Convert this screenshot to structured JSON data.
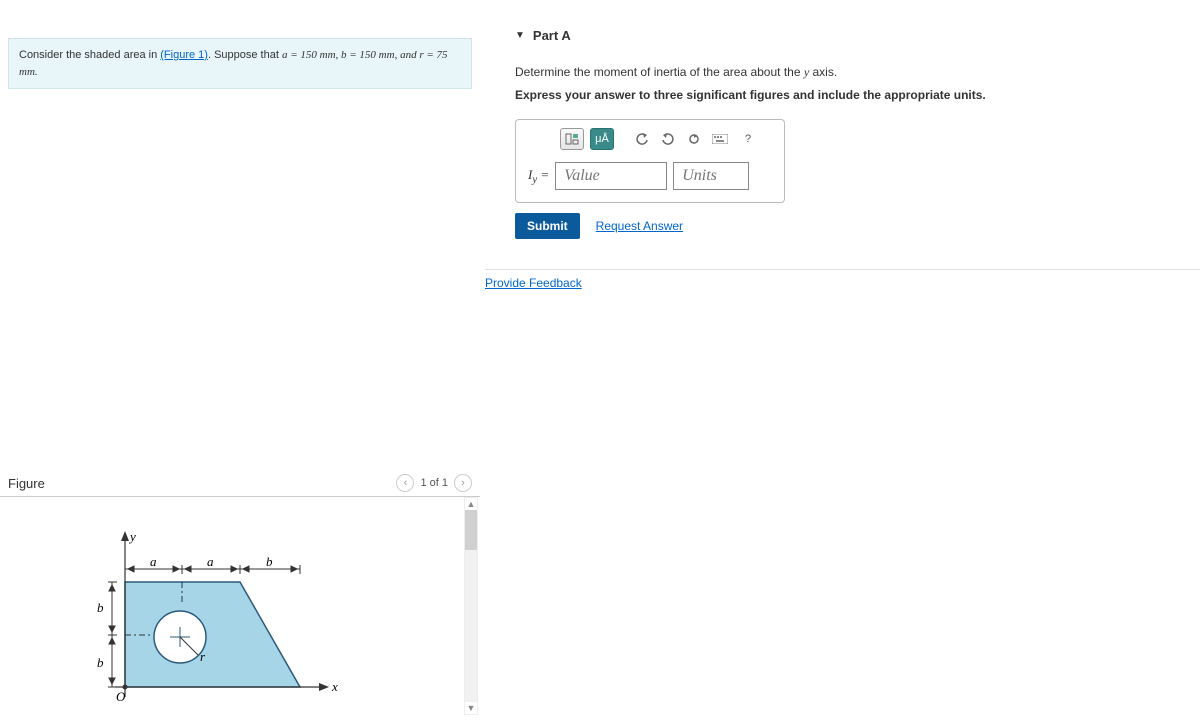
{
  "problem": {
    "pre": "Consider the shaded area in ",
    "figlink": "(Figure 1)",
    "post": ". Suppose that ",
    "eqn": "a = 150 mm, b = 150 mm, and r = 75 mm."
  },
  "figure": {
    "title": "Figure",
    "pager": "1 of 1",
    "labels": {
      "y": "y",
      "x": "x",
      "a": "a",
      "b": "b",
      "r": "r",
      "o": "O"
    }
  },
  "partA": {
    "title": "Part A",
    "q1_pre": "Determine the moment of inertia of the area about the ",
    "q1_var": "y",
    "q1_post": " axis.",
    "q2": "Express your answer to three significant figures and include the appropriate units.",
    "tools": {
      "units_sym": "μÅ",
      "help": "?"
    },
    "input_label": "I",
    "input_sub": "y",
    "input_eq": " = ",
    "value_ph": "Value",
    "units_ph": "Units",
    "submit": "Submit",
    "request": "Request Answer"
  },
  "feedback": {
    "link": "Provide Feedback"
  }
}
